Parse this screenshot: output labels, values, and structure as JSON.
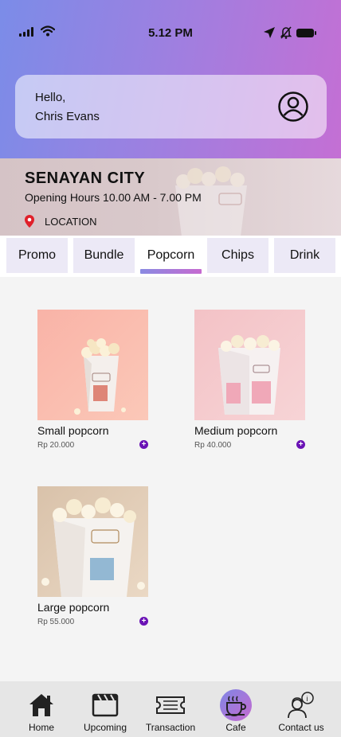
{
  "status_bar": {
    "time": "5.12 PM"
  },
  "greeting": {
    "hello": "Hello,",
    "name": "Chris Evans"
  },
  "location": {
    "title": "SENAYAN CITY",
    "hours": "Opening Hours 10.00 AM - 7.00 PM",
    "location_label": "LOCATION"
  },
  "tabs": [
    {
      "label": "Promo"
    },
    {
      "label": "Bundle"
    },
    {
      "label": "Popcorn",
      "active": true
    },
    {
      "label": "Chips"
    },
    {
      "label": "Drink"
    }
  ],
  "products": [
    {
      "name": "Small popcorn",
      "price": "Rp 20.000"
    },
    {
      "name": "Medium popcorn",
      "price": "Rp 40.000"
    },
    {
      "name": "Large popcorn",
      "price": "Rp 55.000"
    }
  ],
  "bottom_nav": [
    {
      "label": "Home",
      "icon": "home-icon"
    },
    {
      "label": "Upcoming",
      "icon": "clapperboard-icon"
    },
    {
      "label": "Transaction",
      "icon": "ticket-icon"
    },
    {
      "label": "Cafe",
      "icon": "coffee-cup-icon",
      "active": true
    },
    {
      "label": "Contact us",
      "icon": "support-agent-icon"
    }
  ],
  "colors": {
    "gradient_start": "#7b8ce8",
    "gradient_end": "#c46fd4",
    "tab_background": "#ece9f6",
    "add_button": "#6a12b5",
    "location_pin": "#e0202a"
  }
}
